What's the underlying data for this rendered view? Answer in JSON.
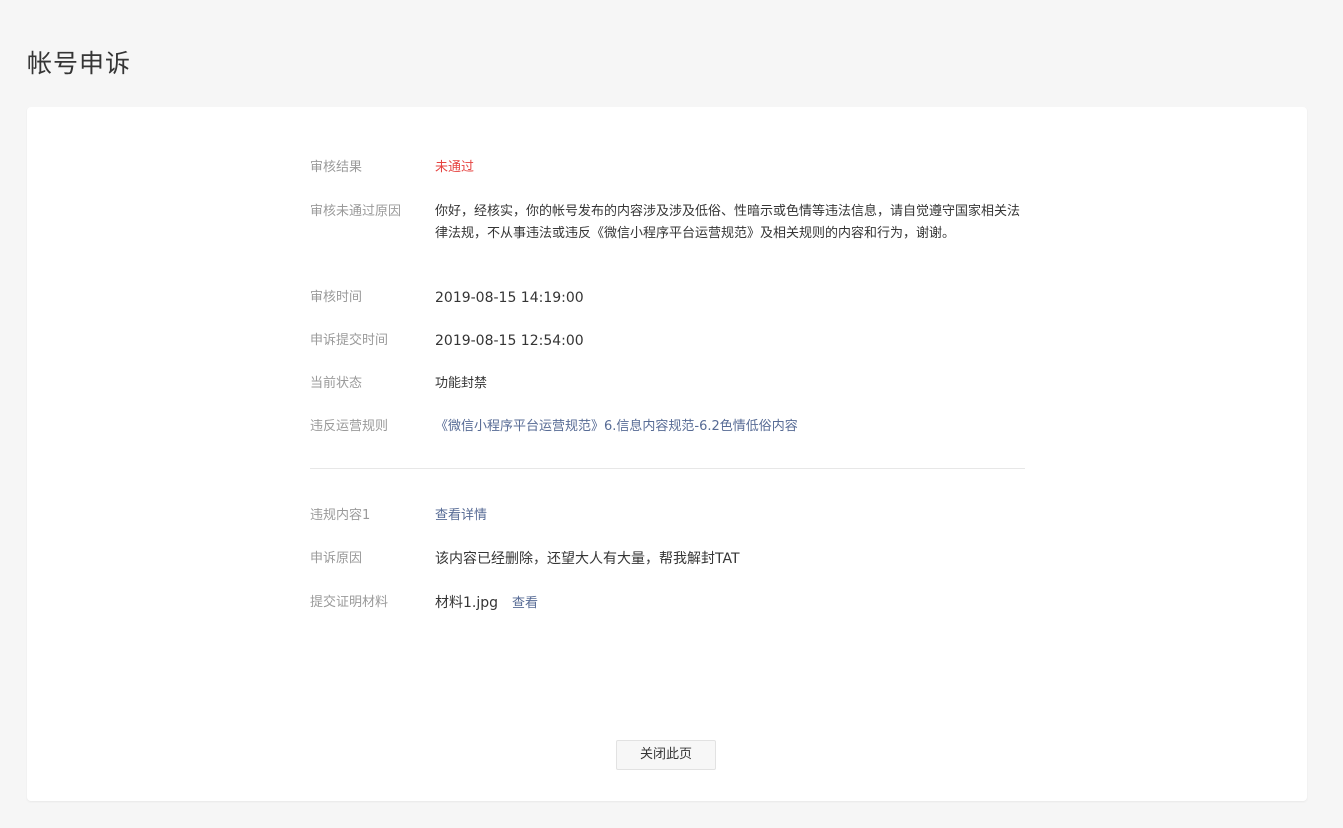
{
  "page_title": "帐号申诉",
  "review": {
    "result_label": "审核结果",
    "result_value": "未通过",
    "reason_label": "审核未通过原因",
    "reason_value": "你好，经核实，你的帐号发布的内容涉及涉及低俗、性暗示或色情等违法信息，请自觉遵守国家相关法律法规，不从事违法或违反《微信小程序平台运营规范》及相关规则的内容和行为，谢谢。",
    "time_label": "审核时间",
    "time_value": "2019-08-15 14:19:00",
    "submit_time_label": "申诉提交时间",
    "submit_time_value": "2019-08-15 12:54:00",
    "status_label": "当前状态",
    "status_value": "功能封禁",
    "rule_label": "违反运营规则",
    "rule_value": "《微信小程序平台运营规范》6.信息内容规范-6.2色情低俗内容"
  },
  "appeal": {
    "content_label": "违规内容1",
    "content_link": "查看详情",
    "reason_label": "申诉原因",
    "reason_value": "该内容已经删除，还望大人有大量，帮我解封TAT",
    "material_label": "提交证明材料",
    "material_file": "材料1.jpg",
    "material_view": "查看"
  },
  "close_button_label": "关闭此页",
  "colors": {
    "fail_red": "#e64340",
    "link_blue": "#576b95",
    "label_gray": "#9a9a9a"
  }
}
